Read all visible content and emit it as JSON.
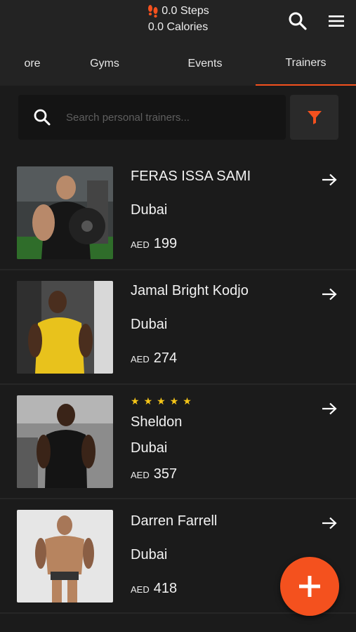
{
  "header": {
    "steps": "0.0 Steps",
    "calories": "0.0 Calories"
  },
  "tabs": [
    {
      "label": "ore"
    },
    {
      "label": "Gyms"
    },
    {
      "label": "Events"
    },
    {
      "label": "Trainers",
      "active": true
    }
  ],
  "search": {
    "placeholder": "Search personal trainers..."
  },
  "trainers": [
    {
      "name": "FERAS ISSA SAMI",
      "city": "Dubai",
      "currency": "AED",
      "price": "199",
      "rating": 0
    },
    {
      "name": "Jamal Bright Kodjo",
      "city": "Dubai",
      "currency": "AED",
      "price": "274",
      "rating": 0
    },
    {
      "name": "Sheldon",
      "city": "Dubai",
      "currency": "AED",
      "price": "357",
      "rating": 5
    },
    {
      "name": "Darren Farrell",
      "city": "Dubai",
      "currency": "AED",
      "price": "418",
      "rating": 0
    }
  ],
  "colors": {
    "accent": "#f4511e",
    "star": "#f5c518",
    "background": "#1b1b1b"
  },
  "icons": {
    "header_search": "search-icon",
    "menu": "hamburger-menu-icon",
    "filter": "funnel-icon",
    "detail": "arrow-right-icon",
    "add": "plus-icon"
  }
}
